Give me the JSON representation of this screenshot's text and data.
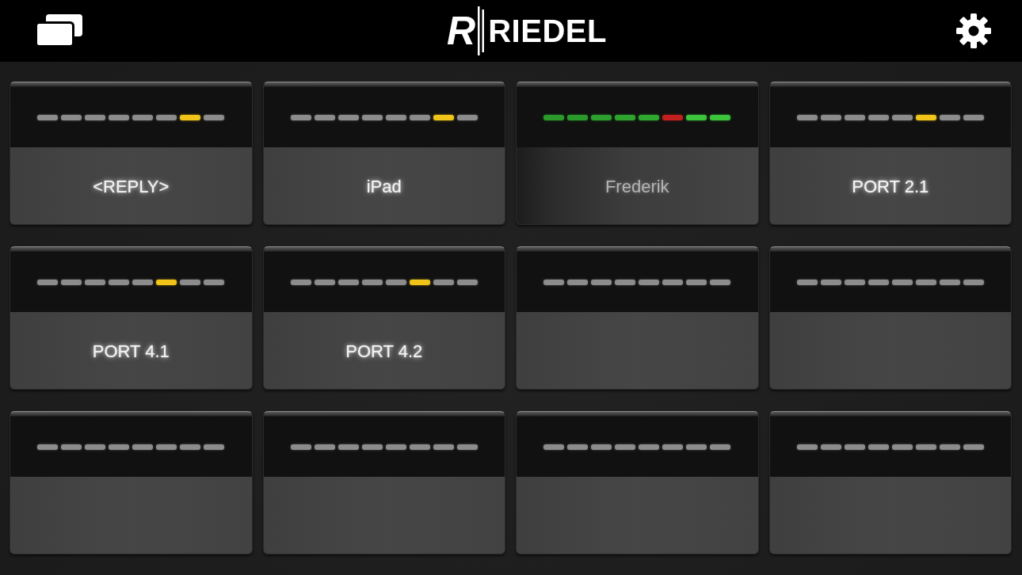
{
  "header": {
    "logo": {
      "mark": "R",
      "text": "RIEDEL"
    }
  },
  "keys": [
    {
      "label": "<REPLY>",
      "dimmed": false,
      "meter": [
        {
          "color": "#8c8c8c"
        },
        {
          "color": "#8c8c8c"
        },
        {
          "color": "#8c8c8c"
        },
        {
          "color": "#8c8c8c"
        },
        {
          "color": "#8c8c8c"
        },
        {
          "color": "#8c8c8c"
        },
        {
          "color": "#f0c419"
        },
        {
          "color": "#8c8c8c"
        }
      ]
    },
    {
      "label": "iPad",
      "dimmed": false,
      "meter": [
        {
          "color": "#8c8c8c"
        },
        {
          "color": "#8c8c8c"
        },
        {
          "color": "#8c8c8c"
        },
        {
          "color": "#8c8c8c"
        },
        {
          "color": "#8c8c8c"
        },
        {
          "color": "#8c8c8c"
        },
        {
          "color": "#f0c419"
        },
        {
          "color": "#8c8c8c"
        }
      ]
    },
    {
      "label": "Frederik",
      "dimmed": true,
      "meter": [
        {
          "color": "#2a9a2a"
        },
        {
          "color": "#2a9a2a"
        },
        {
          "color": "#2c9f2c"
        },
        {
          "color": "#2ea42e"
        },
        {
          "color": "#30a830"
        },
        {
          "color": "#c21f1f"
        },
        {
          "color": "#3cc43c"
        },
        {
          "color": "#3cc43c"
        }
      ]
    },
    {
      "label": "PORT 2.1",
      "dimmed": false,
      "meter": [
        {
          "color": "#8c8c8c"
        },
        {
          "color": "#8c8c8c"
        },
        {
          "color": "#8c8c8c"
        },
        {
          "color": "#8c8c8c"
        },
        {
          "color": "#8c8c8c"
        },
        {
          "color": "#f0c419"
        },
        {
          "color": "#8c8c8c"
        },
        {
          "color": "#8c8c8c"
        }
      ]
    },
    {
      "label": "PORT 4.1",
      "dimmed": false,
      "meter": [
        {
          "color": "#8c8c8c"
        },
        {
          "color": "#8c8c8c"
        },
        {
          "color": "#8c8c8c"
        },
        {
          "color": "#8c8c8c"
        },
        {
          "color": "#8c8c8c"
        },
        {
          "color": "#f0c419"
        },
        {
          "color": "#8c8c8c"
        },
        {
          "color": "#8c8c8c"
        }
      ]
    },
    {
      "label": "PORT 4.2",
      "dimmed": false,
      "meter": [
        {
          "color": "#8c8c8c"
        },
        {
          "color": "#8c8c8c"
        },
        {
          "color": "#8c8c8c"
        },
        {
          "color": "#8c8c8c"
        },
        {
          "color": "#8c8c8c"
        },
        {
          "color": "#f0c419"
        },
        {
          "color": "#8c8c8c"
        },
        {
          "color": "#8c8c8c"
        }
      ]
    },
    {
      "dimmed": false,
      "meter": [
        {
          "color": "#8c8c8c"
        },
        {
          "color": "#8c8c8c"
        },
        {
          "color": "#8c8c8c"
        },
        {
          "color": "#8c8c8c"
        },
        {
          "color": "#8c8c8c"
        },
        {
          "color": "#8c8c8c"
        },
        {
          "color": "#8c8c8c"
        },
        {
          "color": "#8c8c8c"
        }
      ]
    },
    {
      "dimmed": false,
      "meter": [
        {
          "color": "#8c8c8c"
        },
        {
          "color": "#8c8c8c"
        },
        {
          "color": "#8c8c8c"
        },
        {
          "color": "#8c8c8c"
        },
        {
          "color": "#8c8c8c"
        },
        {
          "color": "#8c8c8c"
        },
        {
          "color": "#8c8c8c"
        },
        {
          "color": "#8c8c8c"
        }
      ]
    },
    {
      "dimmed": false,
      "meter": [
        {
          "color": "#8c8c8c"
        },
        {
          "color": "#8c8c8c"
        },
        {
          "color": "#8c8c8c"
        },
        {
          "color": "#8c8c8c"
        },
        {
          "color": "#8c8c8c"
        },
        {
          "color": "#8c8c8c"
        },
        {
          "color": "#8c8c8c"
        },
        {
          "color": "#8c8c8c"
        }
      ]
    },
    {
      "dimmed": false,
      "meter": [
        {
          "color": "#8c8c8c"
        },
        {
          "color": "#8c8c8c"
        },
        {
          "color": "#8c8c8c"
        },
        {
          "color": "#8c8c8c"
        },
        {
          "color": "#8c8c8c"
        },
        {
          "color": "#8c8c8c"
        },
        {
          "color": "#8c8c8c"
        },
        {
          "color": "#8c8c8c"
        }
      ]
    },
    {
      "dimmed": false,
      "meter": [
        {
          "color": "#8c8c8c"
        },
        {
          "color": "#8c8c8c"
        },
        {
          "color": "#8c8c8c"
        },
        {
          "color": "#8c8c8c"
        },
        {
          "color": "#8c8c8c"
        },
        {
          "color": "#8c8c8c"
        },
        {
          "color": "#8c8c8c"
        },
        {
          "color": "#8c8c8c"
        }
      ]
    },
    {
      "dimmed": false,
      "meter": [
        {
          "color": "#8c8c8c"
        },
        {
          "color": "#8c8c8c"
        },
        {
          "color": "#8c8c8c"
        },
        {
          "color": "#8c8c8c"
        },
        {
          "color": "#8c8c8c"
        },
        {
          "color": "#8c8c8c"
        },
        {
          "color": "#8c8c8c"
        },
        {
          "color": "#8c8c8c"
        }
      ]
    }
  ]
}
